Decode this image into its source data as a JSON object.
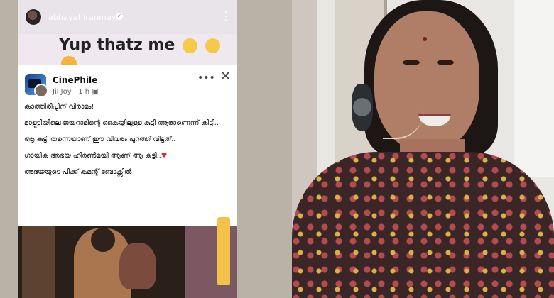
{
  "story": {
    "username": "abhayahiranmayi",
    "caption": "Yup thatz me",
    "verified_icon": "✓",
    "more_icon": "⋮"
  },
  "card": {
    "page_name": "CinePhile",
    "author": "Jil Joy",
    "time": "1 h",
    "more_icon": "•••",
    "close_icon": "✕",
    "lines": [
      "കാത്തിരിപ്പിന് വിരാമം!",
      "മാളൂട്ടിയിലെ ജയറാമിന്റെ കൈയ്യിലുള്ള കുട്ടി ആരാണെന്ന് കിട്ടി..",
      "ആ കുട്ടി തന്നെയാണ് ഈ വിവരം പുറത്ത് വിട്ടത്..",
      "ഗായിക അഭയ ഹിരൺമയി ആണ് ആ കുട്ടി..",
      "അഭയയുടെ പിക്ക് കമന്റ് ബോക്സിൽ"
    ],
    "heart": "♥"
  },
  "colors": {
    "background": "#c9c2b7",
    "story_bg": "#efe8ee",
    "card_bg": "#ffffff",
    "heart": "#e21d28"
  }
}
